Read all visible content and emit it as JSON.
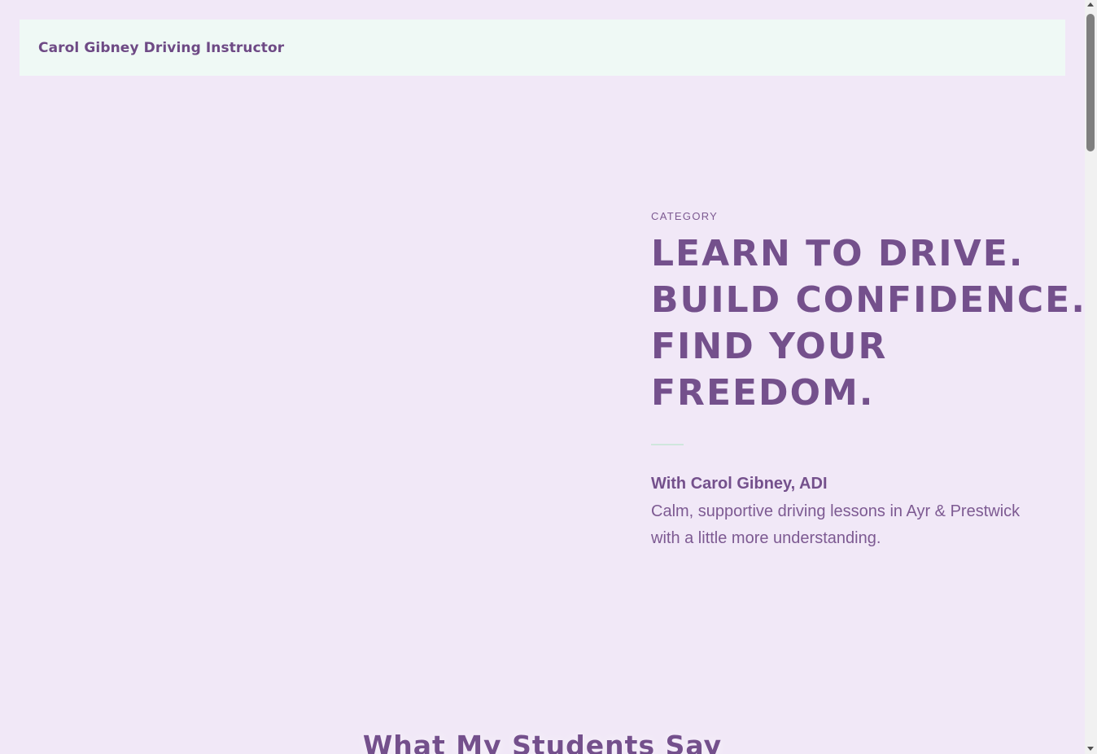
{
  "header": {
    "site_title": "Carol Gibney Driving Instructor"
  },
  "hero": {
    "category": "CATEGORY",
    "headline_lines": [
      "LEARN TO DRIVE.",
      "BUILD CONFIDENCE.",
      "FIND YOUR",
      "FREEDOM."
    ],
    "byline": "With Carol Gibney, ADI",
    "tagline": "Calm, supportive driving lessons in Ayr & Prestwick with a little more understanding."
  },
  "testimonials": {
    "heading": "What My Students Say"
  },
  "colors": {
    "page_background": "#f1e8f7",
    "header_background": "#eff9f5",
    "brand_purple": "#74508c",
    "accent_mint": "#cfe6dd"
  }
}
